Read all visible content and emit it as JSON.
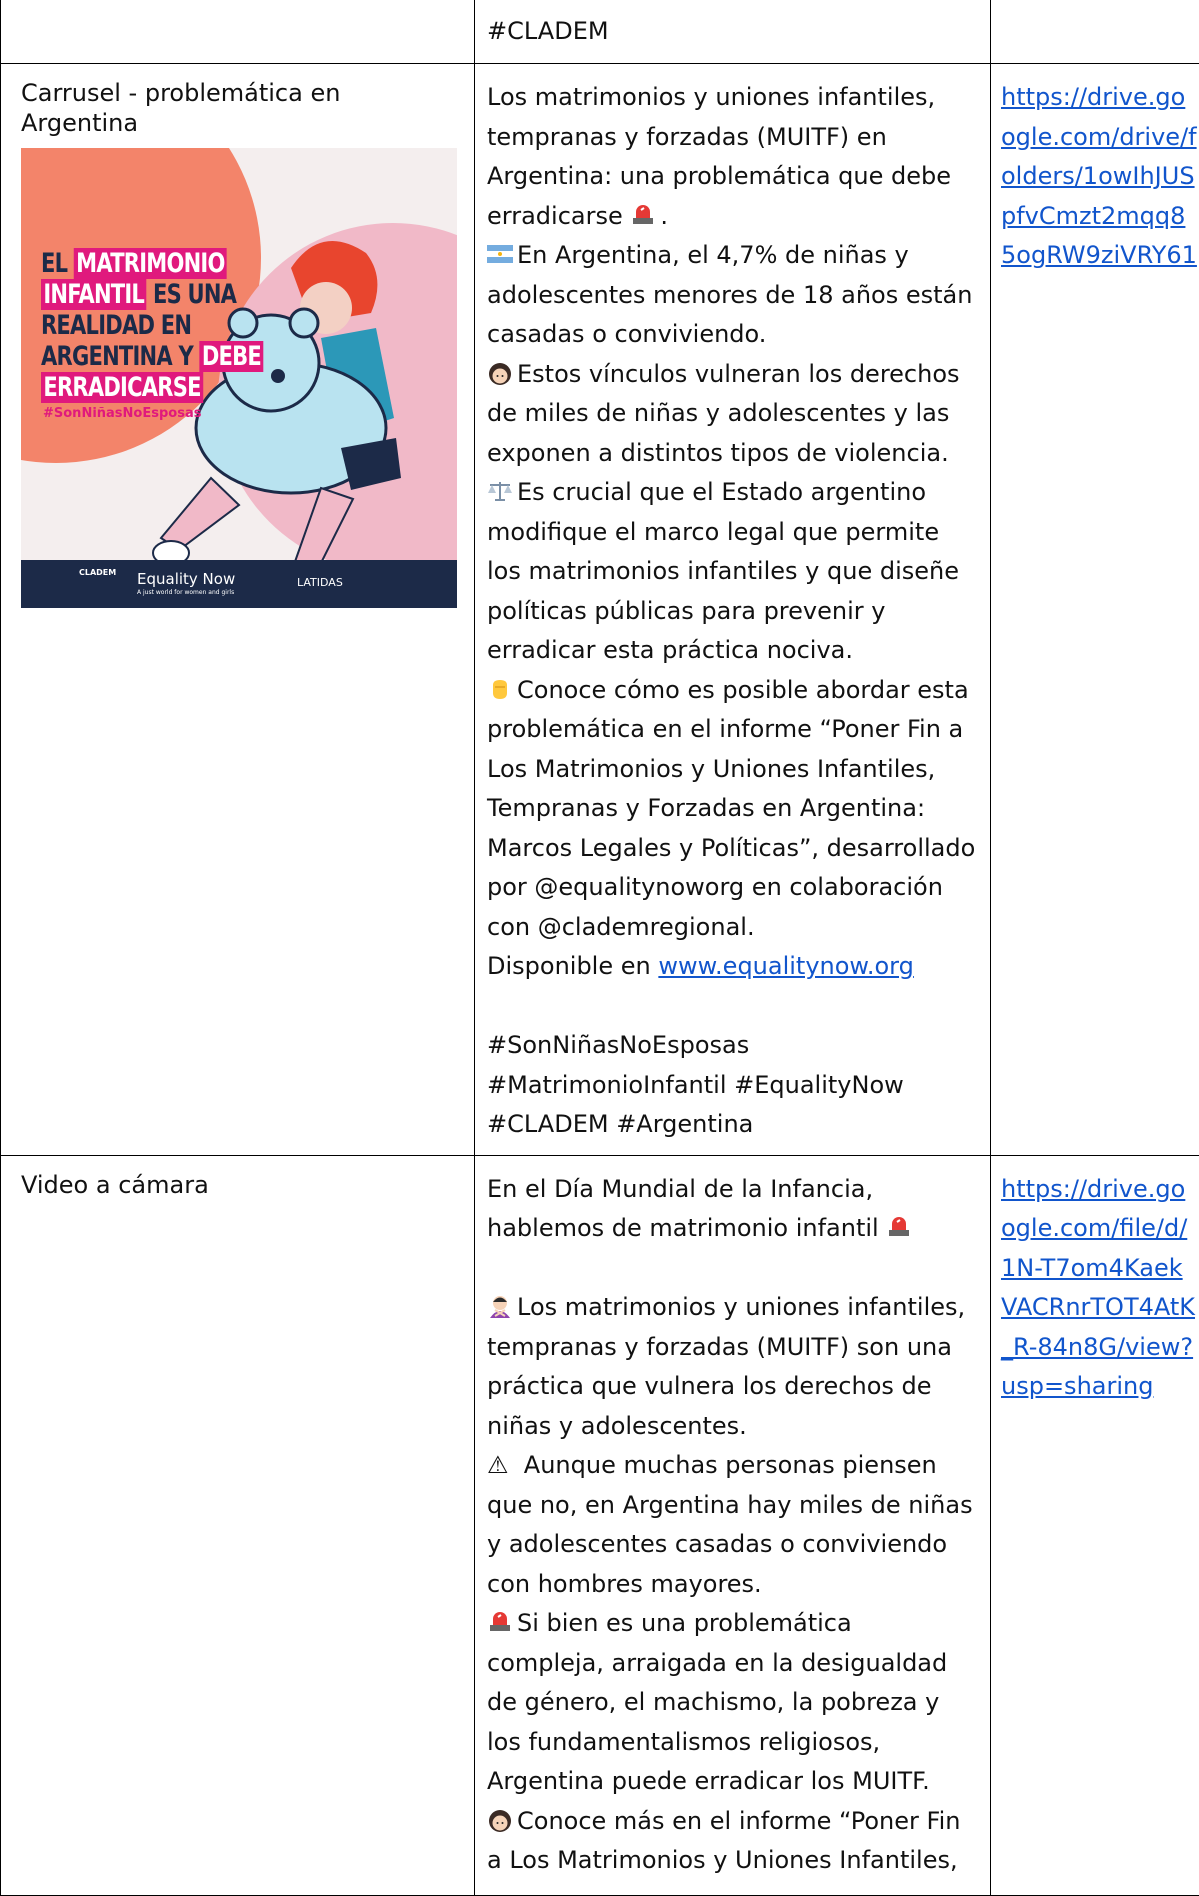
{
  "row0": {
    "col2": "#CLADEM"
  },
  "row1": {
    "col1": "Carrusel - problemática en Argentina",
    "image": {
      "headline1": "EL ",
      "headline1_hl": "MATRIMONIO",
      "headline2_hl": "INFANTIL",
      "headline2": " ES UNA",
      "headline3": "REALIDAD EN",
      "headline4": "ARGENTINA Y ",
      "headline4_hl": "DEBE",
      "headline5_hl": "ERRADICARSE",
      "hashtag": "#SonNiñasNoEsposas",
      "logo1": "CLADEM",
      "logo2": "Equality Now",
      "logo2_sub": "A just world for women and girls",
      "logo3": "LATIDAS",
      "colors": {
        "peach": "#f3846a",
        "pink": "#f1b9c8",
        "magenta": "#e0197d",
        "navy": "#1c2a48"
      }
    },
    "p1": "Los matrimonios y uniones infantiles, tempranas y forzadas (MUITF) en Argentina: una problemática que debe erradicarse",
    "p1_end": ".",
    "p2": "En Argentina, el 4,7% de niñas y adolescentes menores de 18 años están casadas o conviviendo.",
    "p3": "Estos vínculos vulneran los derechos de miles de niñas y adolescentes y las exponen a distintos tipos de violencia.",
    "p4": "Es crucial que el Estado argentino modifique el marco legal que permite los matrimonios infantiles y que diseñe políticas públicas para prevenir y erradicar esta práctica nociva.",
    "p5": "Conoce cómo es posible abordar esta problemática en el informe “Poner Fin a Los Matrimonios y Uniones Infantiles, Tempranas y Forzadas en Argentina: Marcos Legales y Políticas”, desarrollado por @equalitynoworg en colaboración con @clademregional.",
    "p6_prefix": "Disponible en ",
    "p6_link": "www.equalitynow.org",
    "tags": "#SonNiñasNoEsposas #MatrimonioInfantil #EqualityNow #CLADEM #Argentina",
    "col3_link": "https://drive.google.com/drive/folders/1owIhJUSpfvCmzt2mqq85ogRW9ziVRY61",
    "icons": [
      "siren-icon",
      "argentina-flag-icon",
      "girl-icon",
      "scales-icon",
      "raised-fist-icon"
    ]
  },
  "row2": {
    "col1": "Video a cámara",
    "p1": "En el Día Mundial de la Infancia, hablemos de matrimonio infantil",
    "p2": "Los matrimonios y uniones infantiles, tempranas y forzadas (MUITF) son una práctica que vulnera los derechos de niñas y adolescentes.",
    "p3": "Aunque muchas personas piensen que no, en Argentina hay miles de niñas y adolescentes casadas o conviviendo con hombres mayores.",
    "p4": "Si bien es una problemática compleja, arraigada en la desigualdad de género, el machismo, la pobreza y los fundamentalismos religiosos, Argentina puede erradicar los MUITF.",
    "p5": "Conoce más en el informe “Poner Fin a Los Matrimonios y Uniones Infantiles,",
    "p3_icon": "⚠",
    "col3_link": "https://drive.google.com/file/d/1N-T7om4KaekVACRnrTOT4AtK_R-84n8G/view?usp=sharing",
    "icons": [
      "siren-icon",
      "woman-gesturing-no-icon",
      "warning-icon",
      "siren-icon",
      "girl-icon"
    ]
  }
}
